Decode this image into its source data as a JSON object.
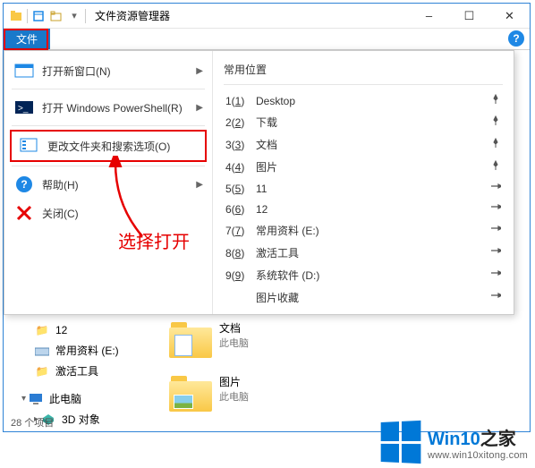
{
  "titlebar": {
    "title": "文件资源管理器"
  },
  "ribbon": {
    "file_tab": "文件"
  },
  "file_menu": {
    "left": {
      "new_window": "打开新窗口(N)",
      "powershell": "打开 Windows PowerShell(R)",
      "options": "更改文件夹和搜索选项(O)",
      "help": "帮助(H)",
      "close": "关闭(C)"
    },
    "right_title": "常用位置",
    "locations": [
      {
        "num": "1",
        "key": "1",
        "label": "Desktop",
        "pinned": true
      },
      {
        "num": "2",
        "key": "2",
        "label": "下载",
        "pinned": true
      },
      {
        "num": "3",
        "key": "3",
        "label": "文档",
        "pinned": true
      },
      {
        "num": "4",
        "key": "4",
        "label": "图片",
        "pinned": true
      },
      {
        "num": "5",
        "key": "5",
        "label": "11",
        "pinned": false
      },
      {
        "num": "6",
        "key": "6",
        "label": "12",
        "pinned": false
      },
      {
        "num": "7",
        "key": "7",
        "label": "常用资料 (E:)",
        "pinned": false
      },
      {
        "num": "8",
        "key": "8",
        "label": "激活工具",
        "pinned": false
      },
      {
        "num": "9",
        "key": "9",
        "label": "系统软件 (D:)",
        "pinned": false
      },
      {
        "num": "",
        "key": "",
        "label": "图片收藏",
        "pinned": false
      }
    ]
  },
  "annotation": "选择打开",
  "sidebar": {
    "items": [
      {
        "label": "12",
        "icon": "folder"
      },
      {
        "label": "常用资料 (E:)",
        "icon": "drive"
      },
      {
        "label": "激活工具",
        "icon": "folder"
      }
    ],
    "pc": "此电脑",
    "sub": [
      "3D 对象"
    ]
  },
  "content": {
    "folders": [
      {
        "name": "文档",
        "sub": "此电脑"
      },
      {
        "name": "图片",
        "sub": "此电脑"
      }
    ]
  },
  "status": "28 个项目",
  "watermark": {
    "brand_a": "Win10",
    "brand_b": "之家",
    "url": "www.win10xitong.com"
  }
}
